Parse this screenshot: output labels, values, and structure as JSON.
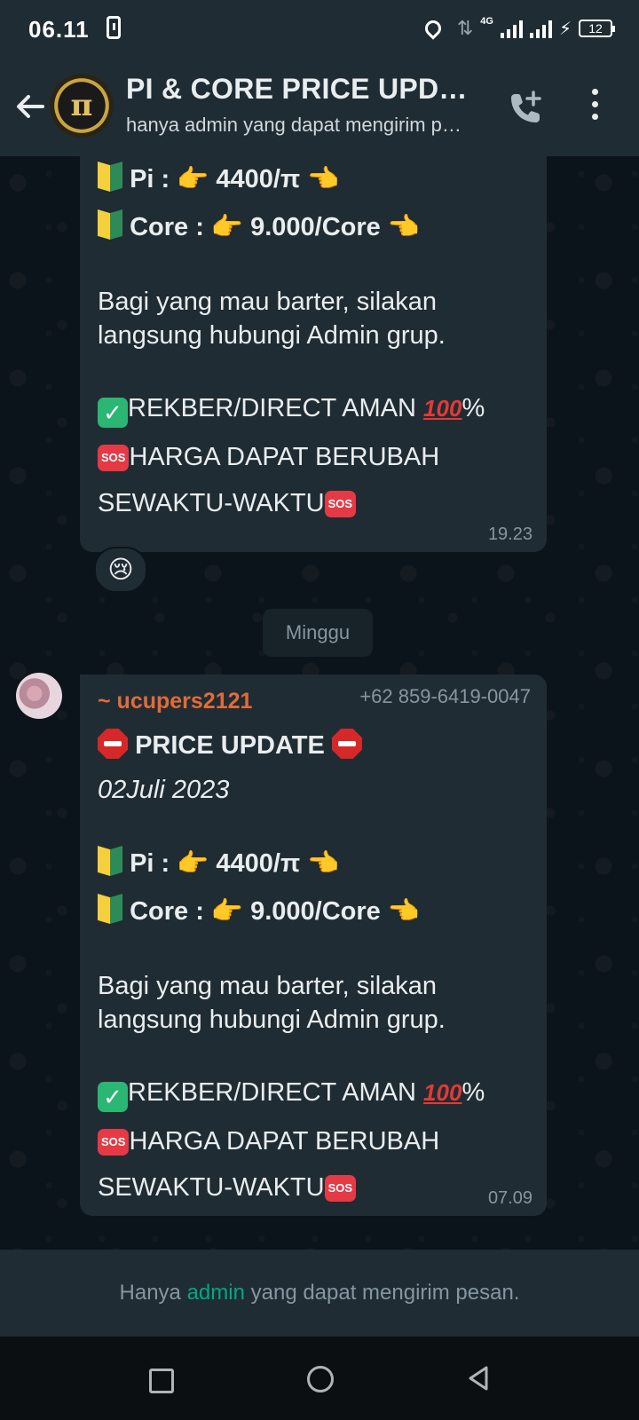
{
  "status_bar": {
    "time": "06.11",
    "network": "4G",
    "battery": "12"
  },
  "header": {
    "title": "PI & CORE PRICE UPDATE",
    "subtitle": "hanya admin yang dapat mengirim pesan",
    "avatar_symbol": "π"
  },
  "messages": [
    {
      "lines": {
        "pi": "Pi : 👉 4400/π 👈",
        "core": "Core : 👉 9.000/Core 👈",
        "barter_1": "Bagi yang mau barter, silakan",
        "barter_2": "langsung hubungi Admin grup.",
        "rekber": "REKBER/DIRECT AMAN",
        "rekber_percent": "%",
        "harga_1": "HARGA DAPAT BERUBAH",
        "harga_2": "SEWAKTU-WAKTU"
      },
      "time": "19.23",
      "reaction": "😢"
    },
    {
      "sender_name": "~ ucupers2121",
      "sender_phone": "+62 859-6419-0047",
      "lines": {
        "title": "PRICE UPDATE",
        "date": "02Juli 2023",
        "pi": "Pi : 👉 4400/π 👈",
        "core": "Core : 👉 9.000/Core 👈",
        "barter_1": "Bagi yang mau barter, silakan",
        "barter_2": "langsung hubungi Admin grup.",
        "rekber": "REKBER/DIRECT AMAN",
        "rekber_percent": "%",
        "harga_1": "HARGA DAPAT BERUBAH",
        "harga_2": "SEWAKTU-WAKTU"
      },
      "time": "07.09"
    }
  ],
  "date_divider": "Minggu",
  "badges": {
    "sos": "SOS",
    "hundred": "100",
    "check": "✓"
  },
  "footer": {
    "before": "Hanya ",
    "admin": "admin",
    "after": " yang dapat mengirim pesan."
  },
  "colors": {
    "header_bg": "#1f2c34",
    "chat_bg": "#0b141a",
    "bubble_bg": "#202c33",
    "accent": "#00a884",
    "sender_name": "#e26b3a"
  },
  "icons": [
    "back-arrow-icon",
    "group-avatar",
    "add-call-icon",
    "more-options-icon",
    "location-icon",
    "nav-recents-icon",
    "nav-home-icon",
    "nav-back-icon"
  ]
}
